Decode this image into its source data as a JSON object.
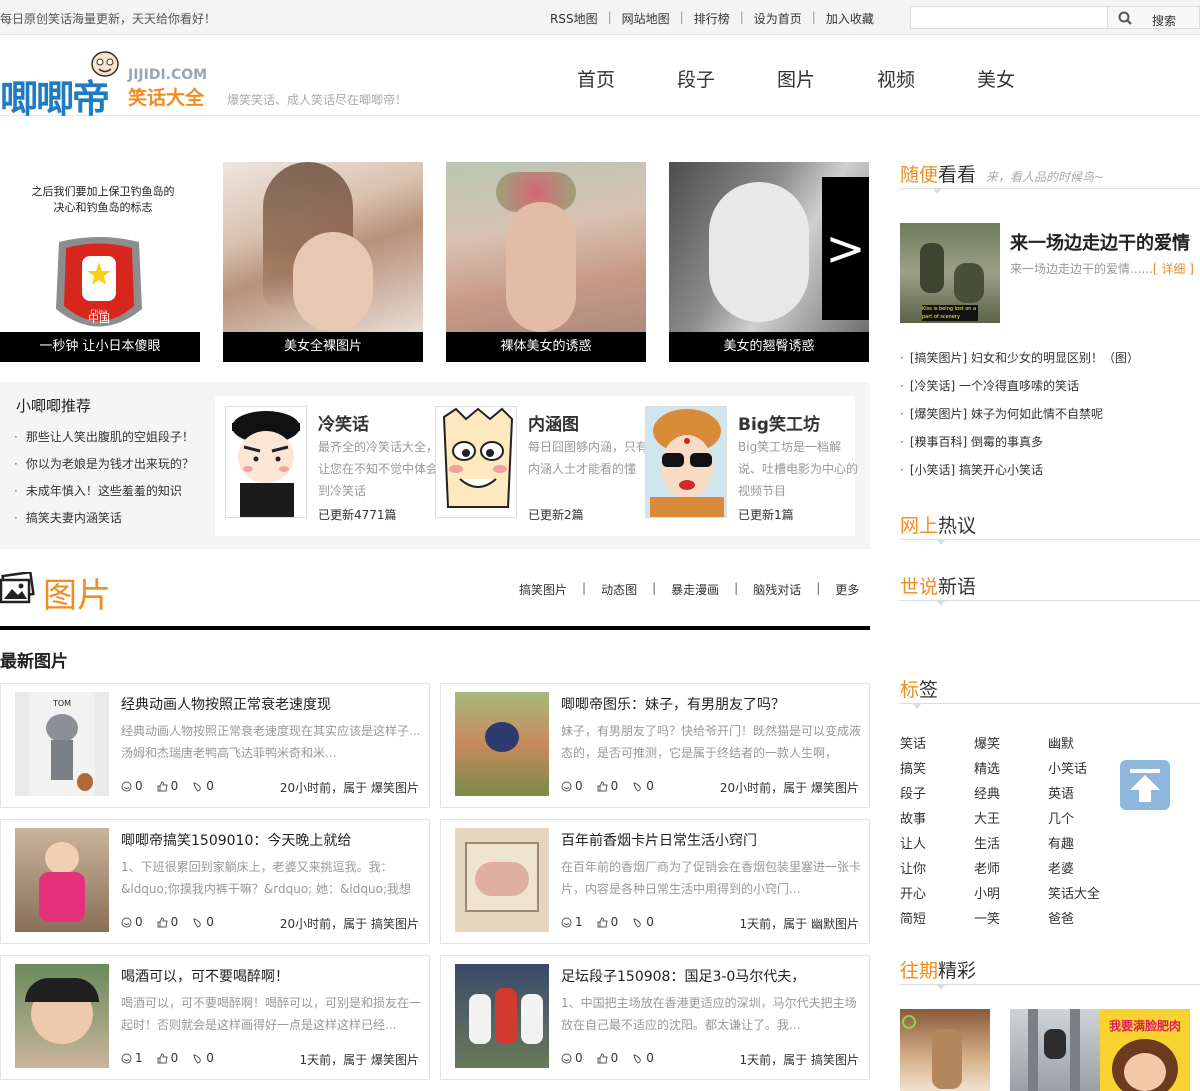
{
  "topbar": {
    "slogan": "每日原创笑话海量更新，天天给你看好！",
    "links": [
      "RSS地图",
      "网站地图",
      "排行榜",
      "设为首页",
      "加入收藏"
    ],
    "search_placeholder": "",
    "search_label": "搜索"
  },
  "header": {
    "logo_main": "唧唧帝",
    "logo_domain": "JIJIDI.COM",
    "logo_sub": "笑话大全",
    "tagline": "爆笑笑话、成人笑话尽在唧唧帝！",
    "nav": [
      "首页",
      "段子",
      "图片",
      "视频",
      "美女"
    ]
  },
  "slider": [
    {
      "caption": "一秒钟 让小日本傻眼",
      "image_text": "之后我们要加上保卫钓鱼岛的决心和钓鱼岛的标志",
      "badge_text": "中国",
      "badge_sub": "China"
    },
    {
      "caption": "美女全裸图片"
    },
    {
      "caption": "裸体美女的诱惑"
    },
    {
      "caption": "美女的翘臀诱惑"
    }
  ],
  "slider_next": ">",
  "recommend": {
    "title": "小唧唧推荐",
    "items": [
      "那些让人笑出腹肌的空姐段子！",
      "你以为老娘是为钱才出来玩的？",
      "未成年慎入！这些羞羞的知识",
      "搞笑夫妻内涵笑话"
    ],
    "categories": [
      {
        "title": "冷笑话",
        "desc": "最齐全的冷笑话大全，让您在不知不觉中体会到冷笑话",
        "updated": "已更新4771篇"
      },
      {
        "title": "内涵图",
        "desc": "每日囧图够内涵，只有内涵人士才能看的懂",
        "updated": "已更新2篇"
      },
      {
        "title": "Big笑工坊",
        "desc": "Big笑工坊是一档解说、吐槽电影为中心的视频节目",
        "updated": "已更新1篇"
      }
    ]
  },
  "section": {
    "title": "图片",
    "links": [
      "搞笑图片",
      "动态图",
      "暴走漫画",
      "脑残对话",
      "更多"
    ],
    "latest_label": "最新图片"
  },
  "cards": [
    {
      "title": "经典动画人物按照正常衰老速度现",
      "excerpt": "经典动画人物按照正常衰老速度现在其实应该是这样子...汤姆和杰瑞唐老鸭高飞达菲鸭米奇和米...",
      "comments": "0",
      "likes": "0",
      "shares": "0",
      "meta": "20小时前，属于 爆笑图片",
      "thumb_text": "TOM"
    },
    {
      "title": "唧唧帝图乐：妹子，有男朋友了吗？",
      "excerpt": "妹子，有男朋友了吗？快给爷开门！既然猫是可以变成液态的，是否可推测，它是属于终结者的一款人生啊，",
      "comments": "0",
      "likes": "0",
      "shares": "0",
      "meta": "20小时前，属于 爆笑图片"
    },
    {
      "title": "唧唧帝搞笑1509010：今天晚上就给",
      "excerpt": "1、下班很累回到家躺床上，老婆又来挑逗我。我：&ldquo;你摸我内裤干嘛？&rdquo; 她：&ldquo;我想",
      "comments": "0",
      "likes": "0",
      "shares": "0",
      "meta": "20小时前，属于 搞笑图片"
    },
    {
      "title": "百年前香烟卡片日常生活小窍门",
      "excerpt": "在百年前的香烟厂商为了促销会在香烟包装里塞进一张卡片，内容是各种日常生活中用得到的小窍门...",
      "comments": "1",
      "likes": "0",
      "shares": "0",
      "meta": "1天前，属于 幽默图片"
    },
    {
      "title": "喝酒可以，可不要喝醉啊！",
      "excerpt": "喝酒可以，可不要喝醉啊！喝醉可以，可别是和损友在一起时！否则就会是这样画得好一点是这样这样已经...",
      "comments": "1",
      "likes": "0",
      "shares": "0",
      "meta": "1天前，属于 爆笑图片"
    },
    {
      "title": "足坛段子150908：国足3-0马尔代夫，",
      "excerpt": "1、中国把主场放在香港更适应的深圳，马尔代夫把主场放在自己最不适应的沈阳。都太谦让了。我...",
      "comments": "0",
      "likes": "0",
      "shares": "0",
      "meta": "1天前，属于 搞笑图片"
    }
  ],
  "sidebar": {
    "random": {
      "title_hl": "随便",
      "title_rest": "看看",
      "sub": "来，看人品的时候鸟~"
    },
    "featured": {
      "title": "来一场边走边干的爱情",
      "desc": "来一场边走边干的爱情......",
      "more": "[ 详细 ]",
      "img_caption": "Kiss is being lost on a part of scenery"
    },
    "list": [
      "[搞笑图片] 妇女和少女的明显区别！（图）",
      "[冷笑话] 一个冷得直哆嗦的笑话",
      "[爆笑图片] 妹子为何如此情不自禁呢",
      "[糗事百科] 倒霉的事真多",
      "[小笑话] 搞笑开心小笑话"
    ],
    "hot": {
      "hl": "网上",
      "rest": "热议"
    },
    "quotes": {
      "hl": "世说",
      "rest": "新语"
    },
    "tags_title": {
      "hl": "标",
      "rest": "签"
    },
    "tags": [
      "笑话",
      "爆笑",
      "幽默",
      "搞笑",
      "精选",
      "小笑话",
      "段子",
      "经典",
      "英语",
      "故事",
      "大王",
      "几个",
      "让人",
      "生活",
      "有趣",
      "让你",
      "老师",
      "老婆",
      "开心",
      "小明",
      "笑话大全",
      "简短",
      "一笑",
      "爸爸"
    ],
    "past": {
      "hl": "往期",
      "rest": "精彩",
      "badge": "我要满脸肥肉"
    }
  },
  "colors": {
    "accent": "#f28c1e",
    "brand_blue": "#1f7cc2",
    "totop": "#8fb6dc"
  }
}
